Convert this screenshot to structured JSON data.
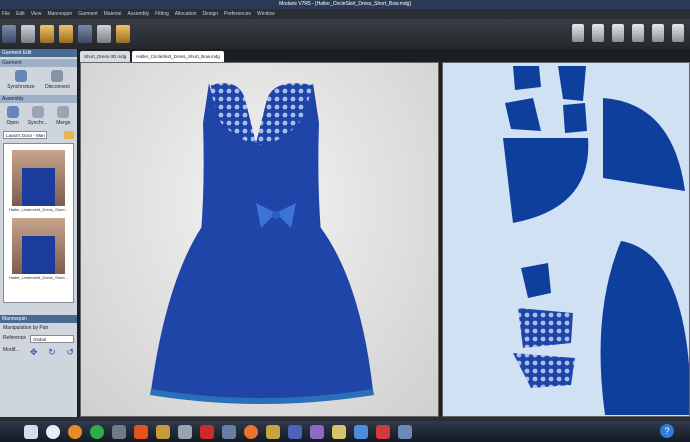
{
  "window": {
    "title": "Modaris V7R5 - [Halter_CircleSkirt_Dress_Short_Bow.mdg]"
  },
  "menu": [
    "File",
    "Edit",
    "View",
    "Mannequin",
    "Garment",
    "Material",
    "Assembly",
    "Fitting",
    "Allocation",
    "Design",
    "Preferences",
    "Window"
  ],
  "left_panel": {
    "header": "Garment Edit",
    "section1_title": "Garment",
    "buttons1": [
      {
        "label": "Synchronize"
      },
      {
        "label": "Disconnect"
      }
    ],
    "section2_title": "Assembly",
    "buttons2": [
      {
        "label": "Open"
      },
      {
        "label": "Synchr..."
      },
      {
        "label": "Merge"
      }
    ],
    "selector_value": "Laura's Docs - Man",
    "thumbnails": [
      "Halter_Underskirt_Dress_Short...",
      "Halter_Underskirt_Dress_Short..."
    ],
    "lower_header": "Mannequin",
    "manip_label": "Manipulation by Pair",
    "reference_label": "Reference",
    "reference_value": "Global",
    "modify_label": "Modif..."
  },
  "tabs": [
    {
      "label": "Short_Dress-3D.mdg",
      "active": false
    },
    {
      "label": "Halter_CircleSkirt_Dress_Short_Bow.mdg",
      "active": true
    }
  ],
  "colors": {
    "dress": "#1f45a8",
    "dress_dark": "#0f2c7c",
    "lace": "#6f8ed6",
    "pattern_bg": "#cfe1f2"
  },
  "taskbar": {
    "help_label": "?"
  }
}
